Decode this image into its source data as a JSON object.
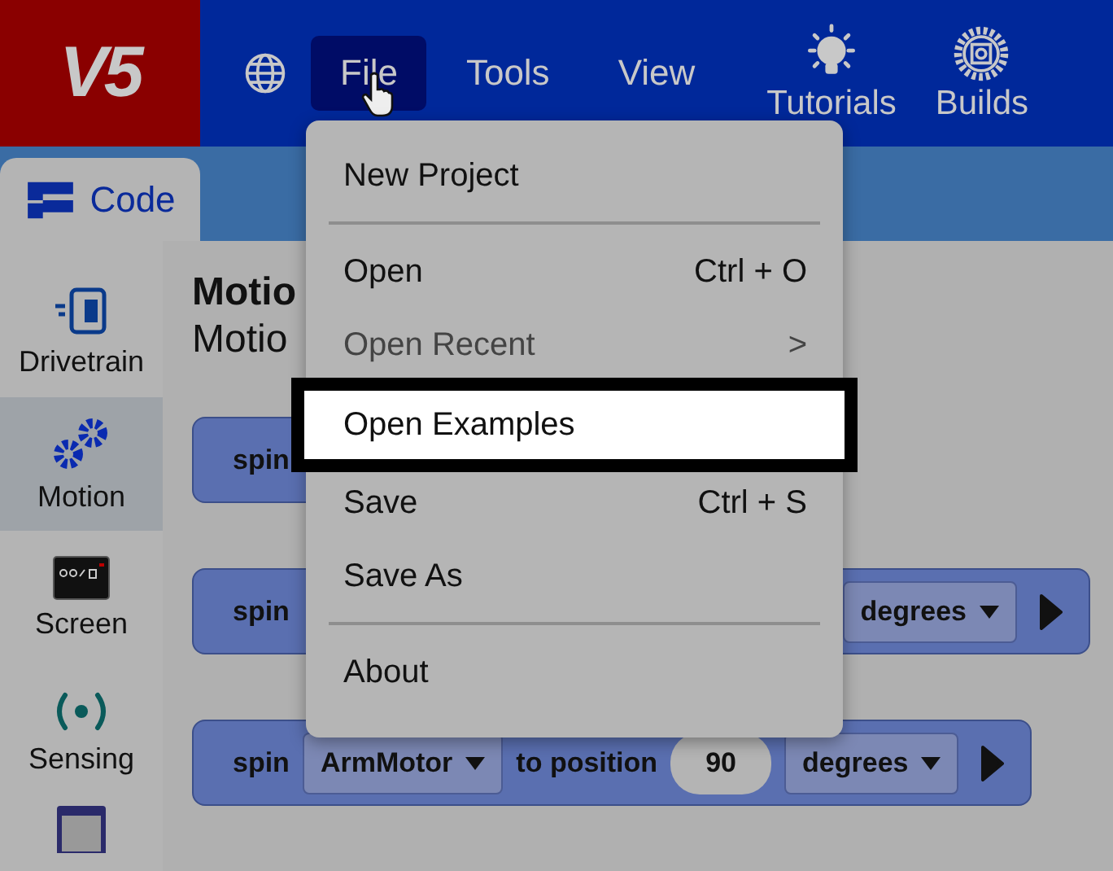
{
  "header": {
    "logo": "V5",
    "nav": [
      {
        "label": "File",
        "selected": true
      },
      {
        "label": "Tools",
        "selected": false
      },
      {
        "label": "View",
        "selected": false
      }
    ],
    "tools": [
      {
        "label": "Tutorials"
      },
      {
        "label": "Builds"
      }
    ]
  },
  "tabs": [
    {
      "label": "Code",
      "selected": true
    }
  ],
  "categories": [
    {
      "label": "Drivetrain",
      "selected": false
    },
    {
      "label": "Motion",
      "selected": true
    },
    {
      "label": "Screen",
      "selected": false
    },
    {
      "label": "Sensing",
      "selected": false
    }
  ],
  "workspace": {
    "title": "Motio",
    "subtitle": "Motio",
    "blocks": [
      {
        "parts": [
          {
            "kind": "label",
            "text": "spin"
          }
        ]
      },
      {
        "parts": [
          {
            "kind": "label",
            "text": "spin"
          },
          {
            "kind": "gap"
          },
          {
            "kind": "dropdown",
            "text": "degrees"
          },
          {
            "kind": "run"
          }
        ]
      },
      {
        "parts": [
          {
            "kind": "label",
            "text": "spin"
          },
          {
            "kind": "dropdown",
            "text": "ArmMotor"
          },
          {
            "kind": "label",
            "text": "to position"
          },
          {
            "kind": "number",
            "text": "90"
          },
          {
            "kind": "dropdown",
            "text": "degrees"
          },
          {
            "kind": "run"
          }
        ]
      }
    ]
  },
  "file_menu": [
    {
      "kind": "item",
      "label": "New Project",
      "highlighted": false,
      "disabled": false
    },
    {
      "kind": "separator"
    },
    {
      "kind": "item",
      "label": "Open",
      "shortcut": "Ctrl + O",
      "highlighted": false,
      "disabled": false
    },
    {
      "kind": "item",
      "label": "Open Recent",
      "shortcut": ">",
      "highlighted": false,
      "disabled": true
    },
    {
      "kind": "item",
      "label": "Open Examples",
      "highlighted": true,
      "disabled": false
    },
    {
      "kind": "item",
      "label": "Save",
      "shortcut": "Ctrl + S",
      "highlighted": false,
      "disabled": false
    },
    {
      "kind": "item",
      "label": "Save As",
      "highlighted": false,
      "disabled": false
    },
    {
      "kind": "separator"
    },
    {
      "kind": "item",
      "label": "About",
      "highlighted": false,
      "disabled": false
    }
  ]
}
